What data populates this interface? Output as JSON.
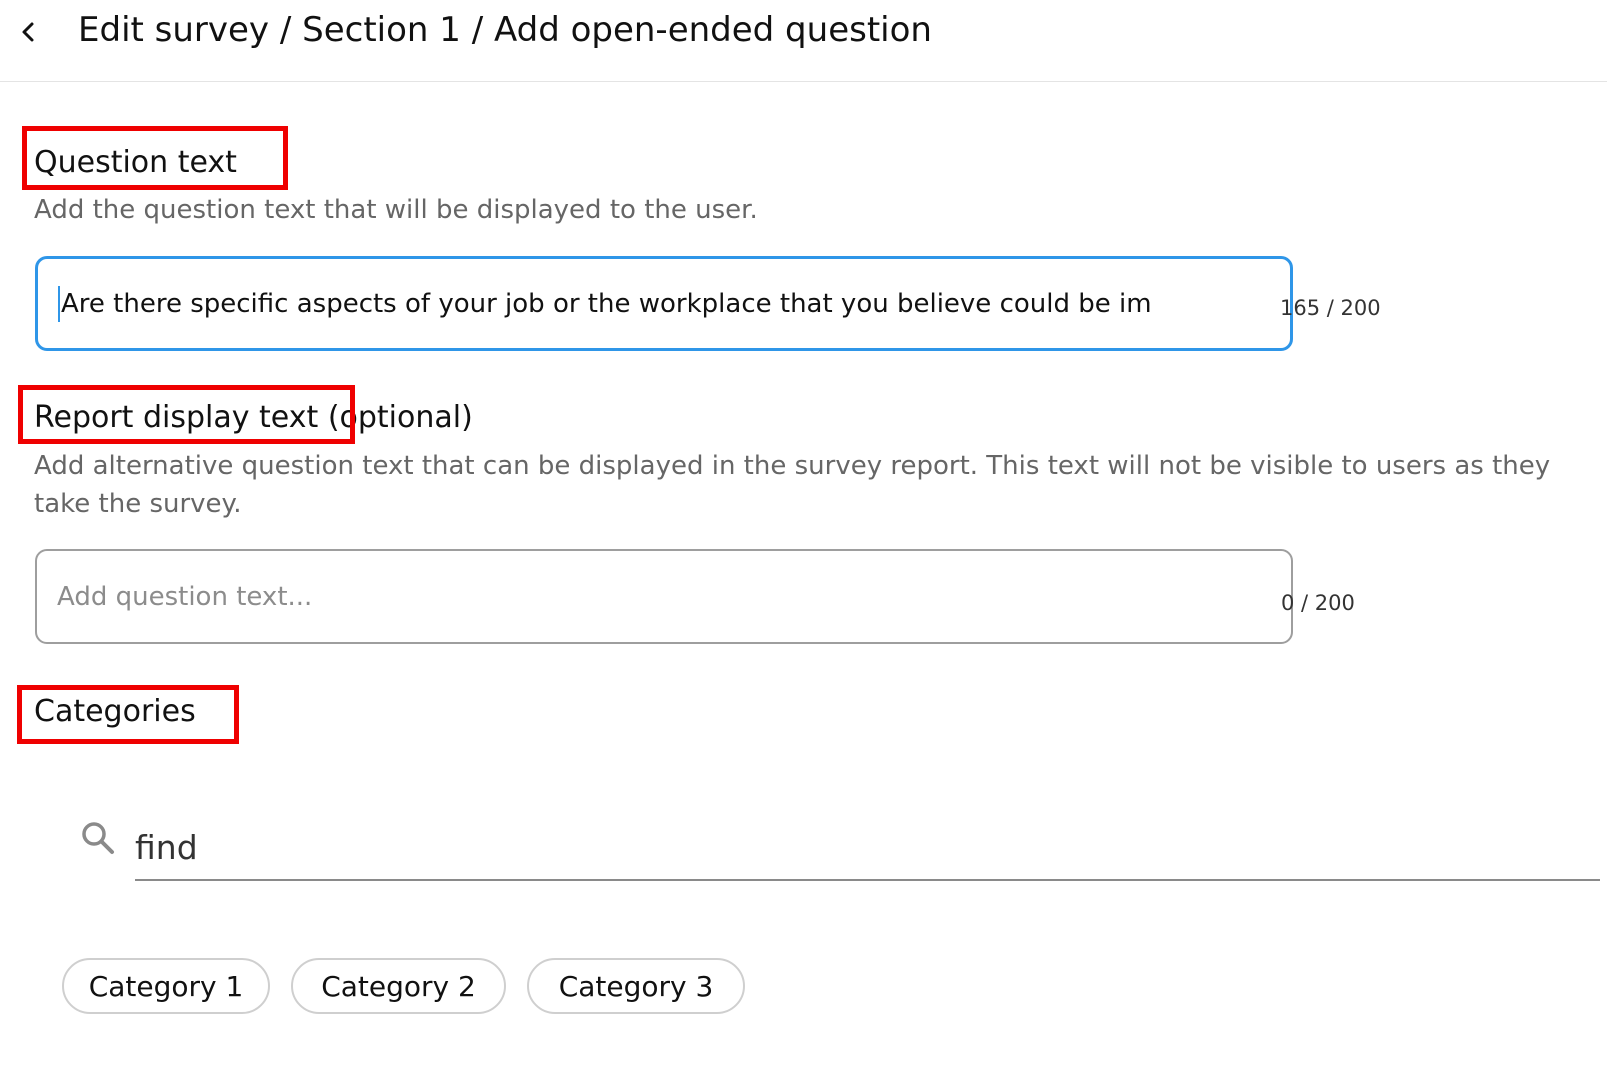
{
  "header": {
    "back_icon": "chevron-left-icon",
    "breadcrumb": "Edit survey / Section 1 / Add open-ended question"
  },
  "question_text": {
    "label": "Question text",
    "hint": "Add the question text that will be displayed to the user.",
    "value": "Are there specific aspects of your job or the workplace that you believe could be im",
    "counter": "165 / 200"
  },
  "report_display_text": {
    "label": "Report display text",
    "label_suffix": "(optional)",
    "hint": "Add alternative question text that can be displayed in the survey report. This text will not be visible to users as they take the survey.",
    "placeholder": "Add question text...",
    "counter": "0 / 200"
  },
  "categories": {
    "label": "Categories",
    "search_icon": "search-icon",
    "search_value": "find",
    "chips": [
      "Category 1",
      "Category 2",
      "Category 3"
    ]
  },
  "colors": {
    "highlight_box": "#ef0000",
    "focus_border": "#2f96e8"
  }
}
